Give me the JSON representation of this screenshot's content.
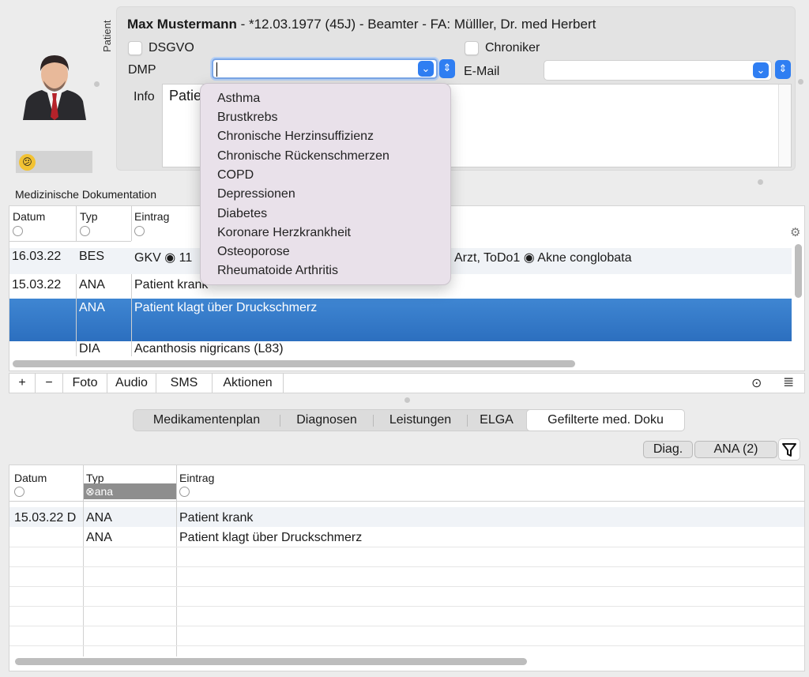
{
  "patient": {
    "section_label": "Patient",
    "name": "Max Mustermann",
    "details": " - *12.03.1977 (45J) - Beamter - FA: Mülller, Dr. med Herbert",
    "dsgvo_label": "DSGVO",
    "chroniker_label": "Chroniker",
    "dmp_label": "DMP",
    "dmp_value": "",
    "email_label": "E-Mail",
    "email_value": "",
    "info_label": "Info",
    "info_value": "Patie"
  },
  "dmp_options": [
    "Asthma",
    "Brustkrebs",
    "Chronische Herzinsuffizienz",
    "Chronische Rückenschmerzen",
    "COPD",
    "Depressionen",
    "Diabetes",
    "Koronare Herzkrankheit",
    "Osteoporose",
    "Rheumatoide Arthritis"
  ],
  "med_doc": {
    "title": "Medizinische Dokumentation",
    "columns": [
      "Datum",
      "Typ",
      "Eintrag"
    ],
    "rows": [
      {
        "datum": "16.03.22",
        "typ": "BES",
        "eintrag_left": "GKV ◉ 11",
        "eintrag_right": "Arzt, ToDo1 ◉ Akne conglobata"
      },
      {
        "datum": "15.03.22",
        "typ": "ANA",
        "eintrag_left": "Patient krank",
        "eintrag_right": ""
      },
      {
        "datum": "",
        "typ": "ANA",
        "eintrag_left": "Patient klagt über Druckschmerz",
        "eintrag_right": ""
      },
      {
        "datum": "",
        "typ": "DIA",
        "eintrag_left": "Acanthosis nigricans (L83)",
        "eintrag_right": ""
      }
    ]
  },
  "toolbar": {
    "add": "+",
    "remove": "−",
    "foto": "Foto",
    "audio": "Audio",
    "sms": "SMS",
    "aktionen": "Aktionen"
  },
  "tabs": [
    {
      "label": "Medikamentenplan"
    },
    {
      "label": "Diagnosen"
    },
    {
      "label": "Leistungen"
    },
    {
      "label": "ELGA"
    },
    {
      "label": "Gefilterte med. Doku"
    }
  ],
  "filters": {
    "diag": "Diag.",
    "ana": "ANA (2)"
  },
  "filtered_doc": {
    "columns": [
      "Datum",
      "Typ",
      "Eintrag"
    ],
    "typ_filter_value": "ana",
    "rows": [
      {
        "datum": "15.03.22",
        "typ": "ANA",
        "eintrag": "Patient krank"
      },
      {
        "datum": "",
        "typ": "ANA",
        "eintrag": "Patient klagt über Druckschmerz"
      }
    ]
  }
}
